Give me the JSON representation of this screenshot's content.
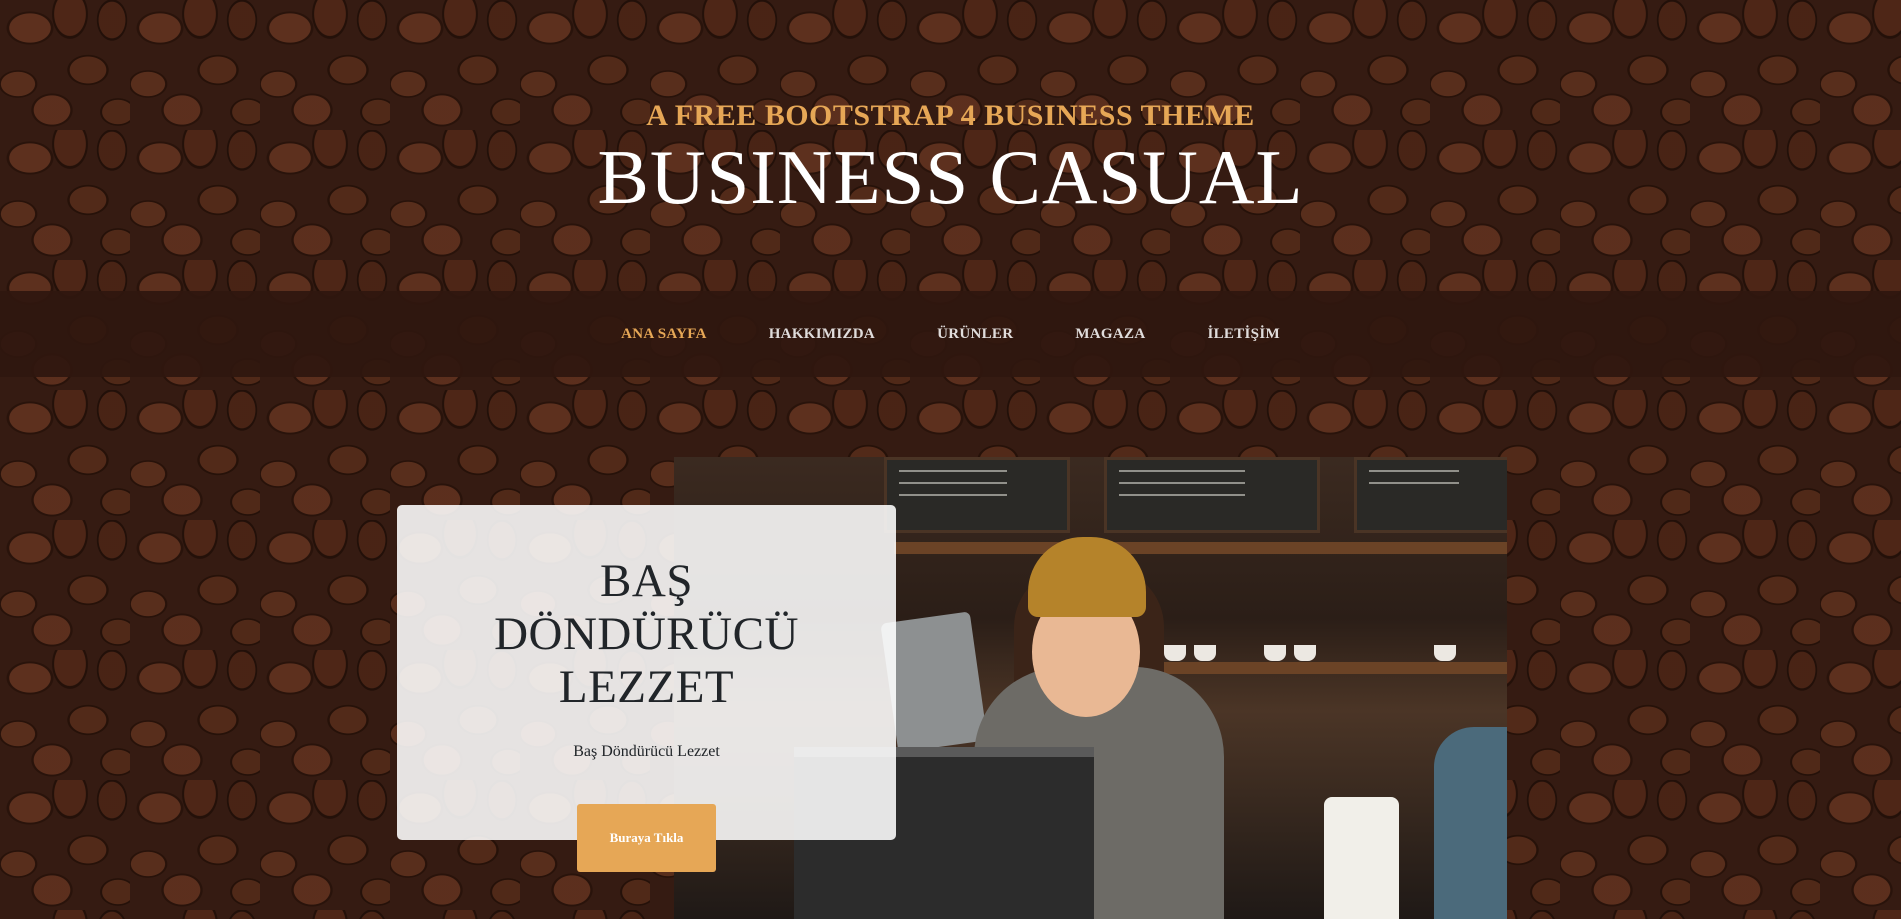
{
  "header": {
    "upper": "A FREE BOOTSTRAP 4 BUSINESS THEME",
    "lower": "BUSINESS CASUAL"
  },
  "nav": {
    "items": [
      {
        "label": "ANA SAYFA",
        "active": true
      },
      {
        "label": "HAKKIMIZDA",
        "active": false
      },
      {
        "label": "ÜRÜNLER",
        "active": false
      },
      {
        "label": "MAGAZA",
        "active": false
      },
      {
        "label": "İLETİŞİM",
        "active": false
      }
    ]
  },
  "intro": {
    "heading_lines": [
      "BAŞ",
      "DÖNDÜRÜCÜ",
      "LEZZET"
    ],
    "text": "Baş Döndürücü Lezzet",
    "button_label": "Buraya Tıkla"
  },
  "colors": {
    "accent": "#e6a756",
    "navbar": "#2f170f",
    "text": "#212529"
  }
}
